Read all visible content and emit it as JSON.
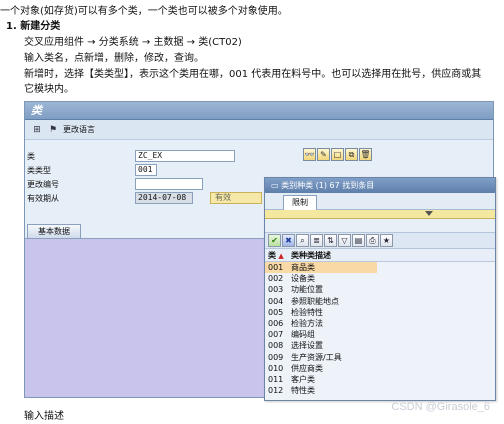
{
  "doc": {
    "line0": "一个对象(如存货)可以有多个类，一个类也可以被多个对象使用。",
    "heading": "1.  新建分类",
    "path": "交叉应用组件 → 分类系统 → 主数据 → 类(CT02)",
    "instr": "输入类名，点新增，删除，修改，查询。",
    "para1": "新增时，选择【类类型】，表示这个类用在哪，001 代表用在料号中。也可以选择用在批号，供应商或其",
    "para2": "它模块内。",
    "caption": "输入描述"
  },
  "sap": {
    "title": "类",
    "toolbar_text": "更改语言",
    "fields": {
      "class_label": "类",
      "class_value": "ZC_EX",
      "class_type_label": "类类型",
      "class_type_value": "001",
      "change_no_label": "更改编号",
      "change_no_value": "",
      "valid_from_label": "有效期从",
      "valid_from_value": "2014-07-08",
      "valid_to_text": "有效"
    },
    "tab_basic": "基本数据"
  },
  "popup": {
    "title": "类别种类 (1)  67 找到条目",
    "tab": "限制",
    "col_code": "类",
    "col_name": "类种类描述",
    "rows": [
      {
        "code": "001",
        "name": "商品类"
      },
      {
        "code": "002",
        "name": "设备类"
      },
      {
        "code": "003",
        "name": "功能位置"
      },
      {
        "code": "004",
        "name": "参照职能地点"
      },
      {
        "code": "005",
        "name": "检验特性"
      },
      {
        "code": "006",
        "name": "检验方法"
      },
      {
        "code": "007",
        "name": "编码组"
      },
      {
        "code": "008",
        "name": "选择设置"
      },
      {
        "code": "009",
        "name": "生产资源/工具"
      },
      {
        "code": "010",
        "name": "供应商类"
      },
      {
        "code": "011",
        "name": "客户类"
      },
      {
        "code": "012",
        "name": "特性类"
      }
    ]
  },
  "watermark": "CSDN @Girasole_6"
}
